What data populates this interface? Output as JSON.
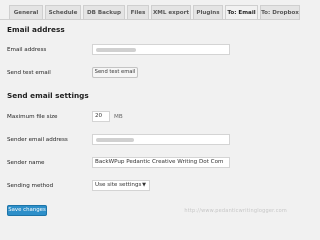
{
  "tabs": [
    {
      "label": "General"
    },
    {
      "label": "Schedule"
    },
    {
      "label": "DB Backup"
    },
    {
      "label": "Files"
    },
    {
      "label": "XML export"
    },
    {
      "label": "Plugins"
    },
    {
      "label": "To: Email",
      "active": true
    },
    {
      "label": "To: Dropbox"
    }
  ],
  "email_section": {
    "heading": "Email address",
    "email_address_label": "Email address",
    "send_test_label": "Send test email",
    "send_test_button": "Send test email"
  },
  "settings_section": {
    "heading": "Send email settings",
    "max_file_size_label": "Maximum file size",
    "max_file_size_value": "20",
    "max_file_size_unit": "MB",
    "sender_email_label": "Sender email address",
    "sender_name_label": "Sender name",
    "sender_name_value": "BackWPup Pedantic Creative Writing Dot Com",
    "sending_method_label": "Sending method",
    "sending_method_value": "Use site settings"
  },
  "footer": {
    "save_button": "Save changes",
    "watermark": "http://www.pedanticwritinglogger.com"
  },
  "colors": {
    "primary": "#2d8fc9",
    "background": "#f1f1f1"
  }
}
